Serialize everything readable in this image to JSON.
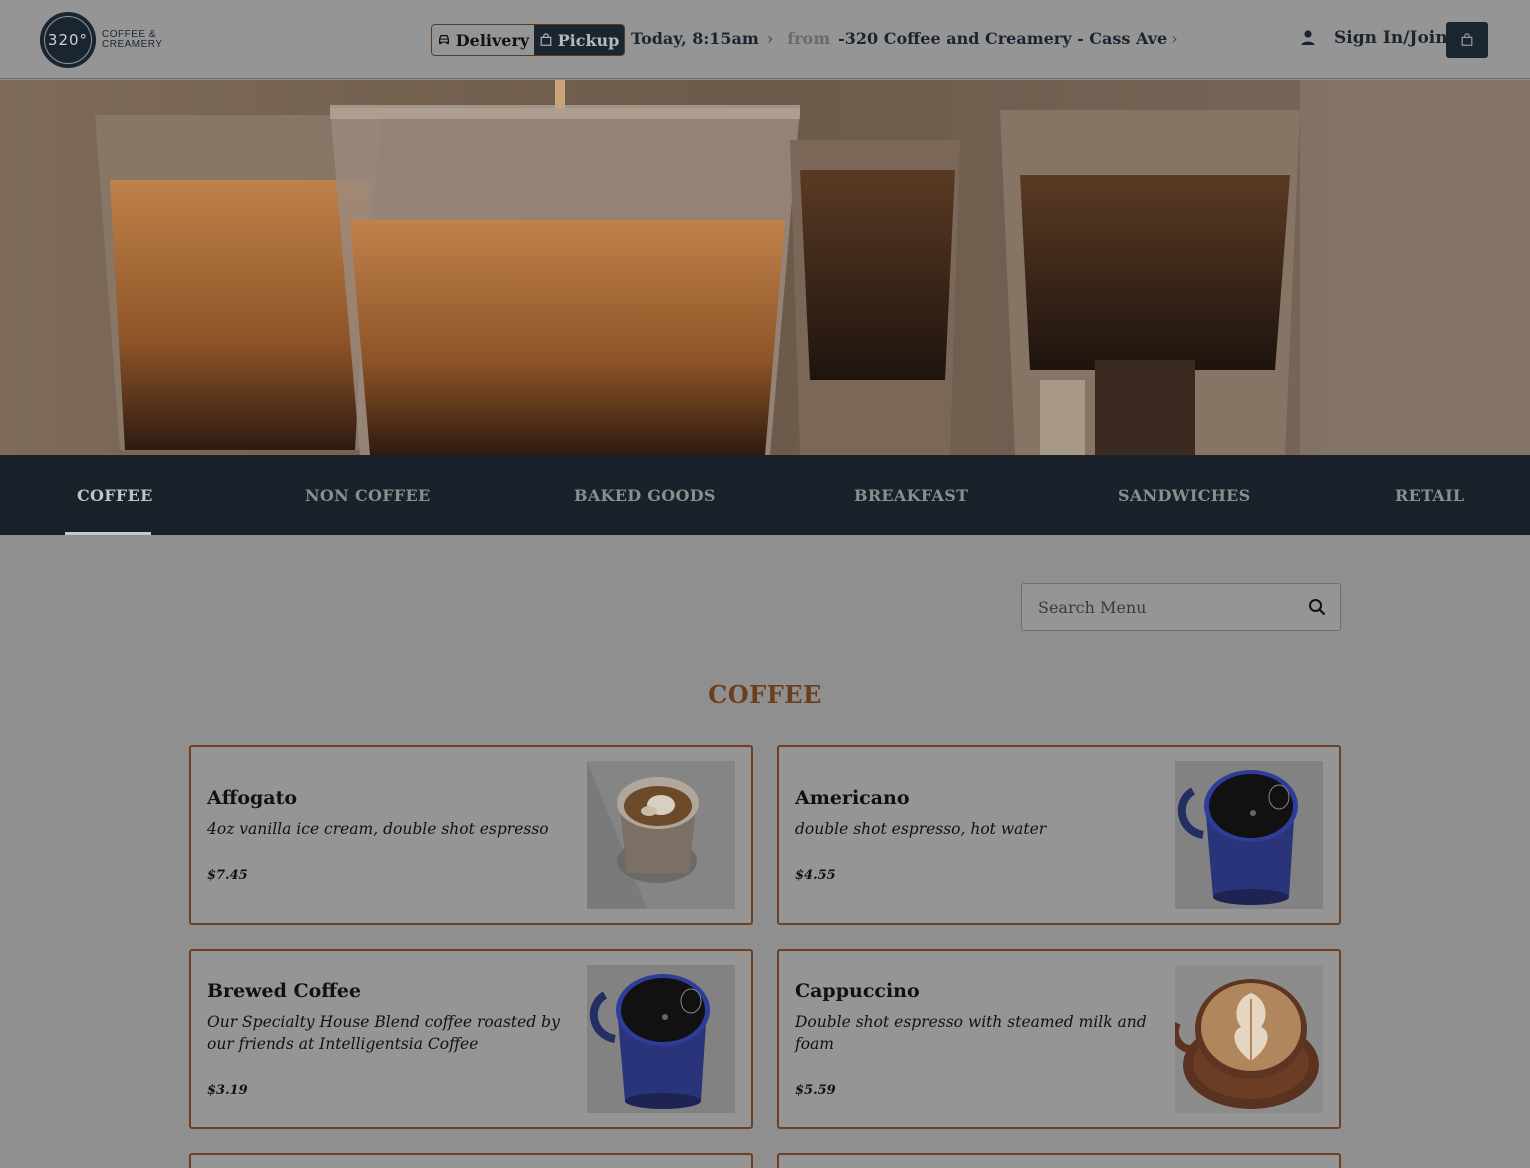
{
  "header": {
    "logo": {
      "mark": "320°",
      "line1": "COFFEE &",
      "line2": "CREAMERY"
    },
    "modes": {
      "delivery": "Delivery",
      "pickup": "Pickup"
    },
    "order_time": "Today, 8:15am",
    "from_label": "from",
    "location": "-320 Coffee and Creamery - Cass Ave",
    "signin": "Sign In/Join"
  },
  "categories": [
    "COFFEE",
    "NON COFFEE",
    "BAKED GOODS",
    "BREAKFAST",
    "SANDWICHES",
    "RETAIL"
  ],
  "active_category": "COFFEE",
  "search": {
    "placeholder": "Search Menu"
  },
  "section": {
    "title": "COFFEE"
  },
  "items": [
    {
      "name": "Affogato",
      "description": "4oz vanilla ice cream, double shot espresso",
      "price": "$7.45",
      "image": "affogato-photo"
    },
    {
      "name": "Americano",
      "description": "double shot espresso, hot water",
      "price": "$4.55",
      "image": "blue-mug-photo"
    },
    {
      "name": "Brewed Coffee",
      "description": "Our Specialty House Blend coffee roasted by our friends at Intelligentsia Coffee",
      "price": "$3.19",
      "image": "blue-mug-photo"
    },
    {
      "name": "Cappuccino",
      "description": "Double shot espresso with steamed milk and foam",
      "price": "$5.59",
      "image": "latte-art-photo"
    }
  ],
  "colors": {
    "navy": "#1b2530",
    "accent_brown": "#6b3f1e",
    "overlay_gray": "#959595"
  }
}
